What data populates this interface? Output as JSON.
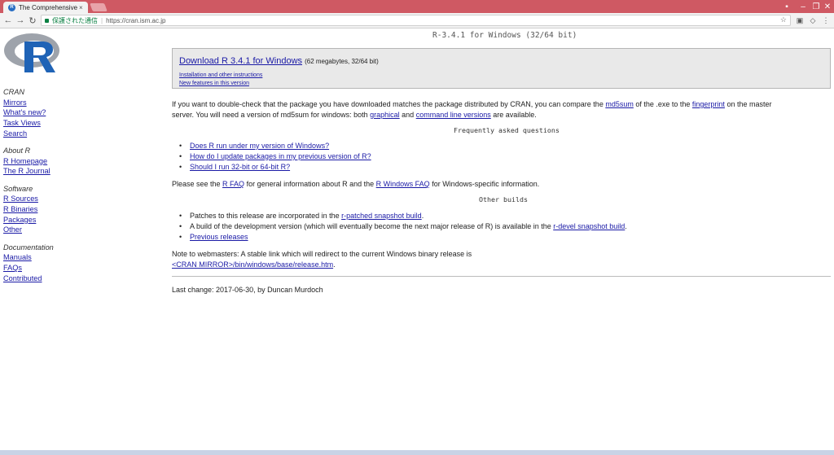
{
  "browser": {
    "tab_title": "The Comprehensive R",
    "tab_favicon": "R",
    "secure_label": "保護された通信",
    "url": "https://cran.ism.ac.jp"
  },
  "sidebar": {
    "sections": [
      {
        "head": "CRAN",
        "links": [
          "Mirrors",
          "What's new?",
          "Task Views",
          "Search"
        ]
      },
      {
        "head": "About R",
        "links": [
          "R Homepage",
          "The R Journal"
        ]
      },
      {
        "head": "Software",
        "links": [
          "R Sources",
          "R Binaries",
          "Packages",
          "Other"
        ]
      },
      {
        "head": "Documentation",
        "links": [
          "Manuals",
          "FAQs",
          "Contributed"
        ]
      }
    ]
  },
  "main": {
    "title": "R-3.4.1 for Windows (32/64 bit)",
    "download_link": "Download R 3.4.1 for Windows",
    "download_size": "(62 megabytes, 32/64 bit)",
    "install_link": "Installation and other instructions",
    "features_link": "New features in this version",
    "check_text_1": "If you want to double-check that the package you have downloaded matches the package distributed by CRAN, you can compare the ",
    "md5sum_link": "md5sum",
    "check_text_2": " of the .exe to the ",
    "fingerprint_link": "fingerprint",
    "check_text_3": " on the master",
    "check_text_4": "server. You will need a version of md5sum for windows: both ",
    "graphical_link": "graphical",
    "check_text_5": " and ",
    "cmdline_link": "command line versions",
    "check_text_6": " are available.",
    "faq_heading": "Frequently asked questions",
    "faq_items": [
      "Does R run under my version of Windows?",
      "How do I update packages in my previous version of R?",
      "Should I run 32-bit or 64-bit R?"
    ],
    "see_text_1": "Please see the ",
    "rfaq_link": "R FAQ",
    "see_text_2": " for general information about R and the ",
    "winfaq_link": "R Windows FAQ",
    "see_text_3": " for Windows-specific information.",
    "other_heading": "Other builds",
    "build_1_text": "Patches to this release are incorporated in the ",
    "build_1_link": "r-patched snapshot build",
    "build_1_end": ".",
    "build_2_text": "A build of the development version (which will eventually become the next major release of R) is available in the ",
    "build_2_link": "r-devel snapshot build",
    "build_2_end": ".",
    "build_3_link": "Previous releases",
    "note_text": "Note to webmasters: A stable link which will redirect to the current Windows binary release is",
    "note_link": "<CRAN MIRROR>/bin/windows/base/release.htm",
    "note_end": ".",
    "last_change": "Last change: 2017-06-30, by Duncan Murdoch"
  }
}
